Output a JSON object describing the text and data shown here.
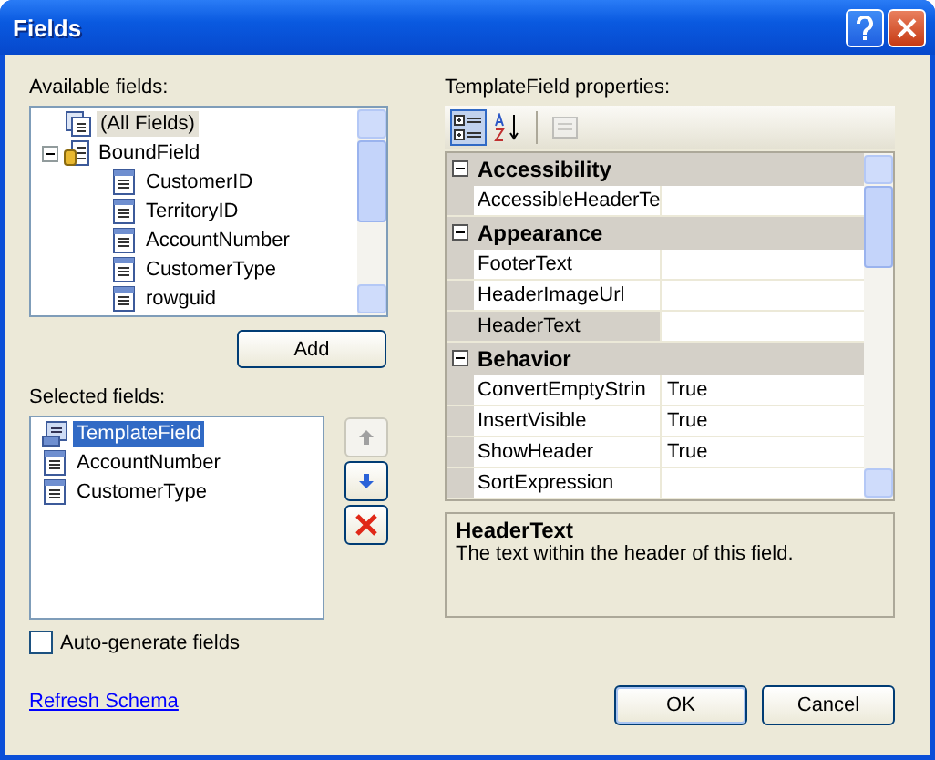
{
  "window": {
    "title": "Fields"
  },
  "available_fields": {
    "label": "Available fields:",
    "items": [
      {
        "label": "(All Fields)",
        "kind": "all",
        "selected": true
      },
      {
        "label": "BoundField",
        "kind": "group",
        "selected": false,
        "expanded": true,
        "children": [
          {
            "label": "CustomerID",
            "kind": "field",
            "selected": false
          },
          {
            "label": "TerritoryID",
            "kind": "field",
            "selected": false
          },
          {
            "label": "AccountNumber",
            "kind": "field",
            "selected": false
          },
          {
            "label": "CustomerType",
            "kind": "field",
            "selected": false
          },
          {
            "label": "rowguid",
            "kind": "field",
            "selected": false
          }
        ]
      }
    ]
  },
  "add_button": {
    "label": "Add"
  },
  "selected_fields": {
    "label": "Selected fields:",
    "items": [
      {
        "label": "TemplateField",
        "kind": "template",
        "selected": true
      },
      {
        "label": "AccountNumber",
        "kind": "field",
        "selected": false
      },
      {
        "label": "CustomerType",
        "kind": "field",
        "selected": false
      }
    ]
  },
  "move_buttons": [
    {
      "kind": "up",
      "disabled": true
    },
    {
      "kind": "down",
      "disabled": false
    },
    {
      "kind": "delete",
      "disabled": false
    }
  ],
  "auto_generate": {
    "label": "Auto-generate fields",
    "checked": false
  },
  "refresh_link": {
    "label": "Refresh Schema"
  },
  "properties": {
    "label": "TemplateField properties:",
    "toolbar": [
      {
        "kind": "categorized",
        "selected": true,
        "disabled": false
      },
      {
        "kind": "alphabetical",
        "selected": false,
        "disabled": false
      },
      {
        "kind": "pages",
        "selected": false,
        "disabled": true
      }
    ],
    "categories": [
      {
        "name": "Accessibility",
        "expanded": true,
        "rows": [
          {
            "name": "AccessibleHeaderTe",
            "value": "",
            "selected": false
          }
        ]
      },
      {
        "name": "Appearance",
        "expanded": true,
        "rows": [
          {
            "name": "FooterText",
            "value": "",
            "selected": false
          },
          {
            "name": "HeaderImageUrl",
            "value": "",
            "selected": false
          },
          {
            "name": "HeaderText",
            "value": "",
            "selected": true
          }
        ]
      },
      {
        "name": "Behavior",
        "expanded": true,
        "rows": [
          {
            "name": "ConvertEmptyStrin",
            "value": "True",
            "selected": false
          },
          {
            "name": "InsertVisible",
            "value": "True",
            "selected": false
          },
          {
            "name": "ShowHeader",
            "value": "True",
            "selected": false
          },
          {
            "name": "SortExpression",
            "value": "",
            "selected": false
          }
        ]
      }
    ],
    "description": {
      "title": "HeaderText",
      "text": "The text within the header of this field."
    }
  },
  "buttons": [
    {
      "label": "OK",
      "default": true
    },
    {
      "label": "Cancel",
      "default": false
    }
  ]
}
